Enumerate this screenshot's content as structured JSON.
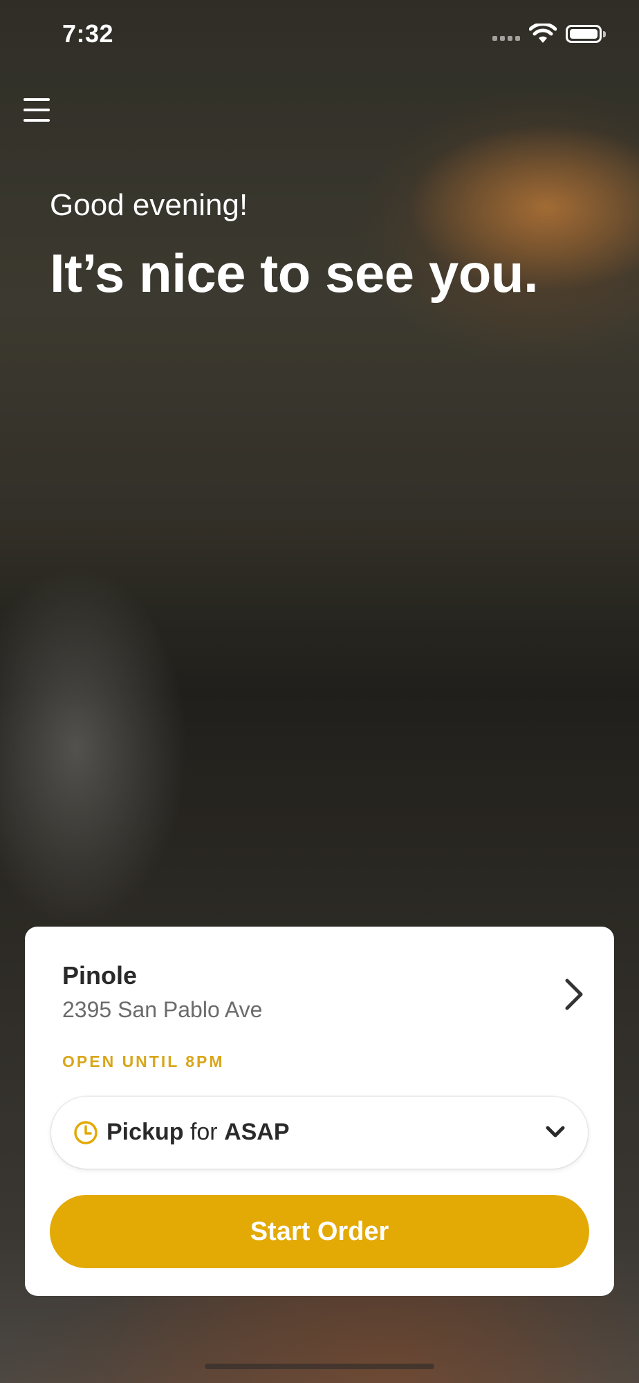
{
  "status_bar": {
    "time": "7:32"
  },
  "hero": {
    "greeting": "Good evening!",
    "headline": "It’s nice to see you."
  },
  "store": {
    "name": "Pinole",
    "address": "2395 San Pablo Ave",
    "open_status": "OPEN UNTIL 8PM"
  },
  "order_mode": {
    "mode": "Pickup",
    "connector": "for",
    "time": "ASAP"
  },
  "actions": {
    "start_order": "Start Order"
  },
  "colors": {
    "accent": "#e3a905",
    "open_status": "#d8a61a"
  },
  "icons": {
    "menu": "hamburger-menu-icon",
    "store_chevron": "chevron-right-icon",
    "clock": "clock-icon",
    "dropdown": "chevron-down-icon"
  }
}
